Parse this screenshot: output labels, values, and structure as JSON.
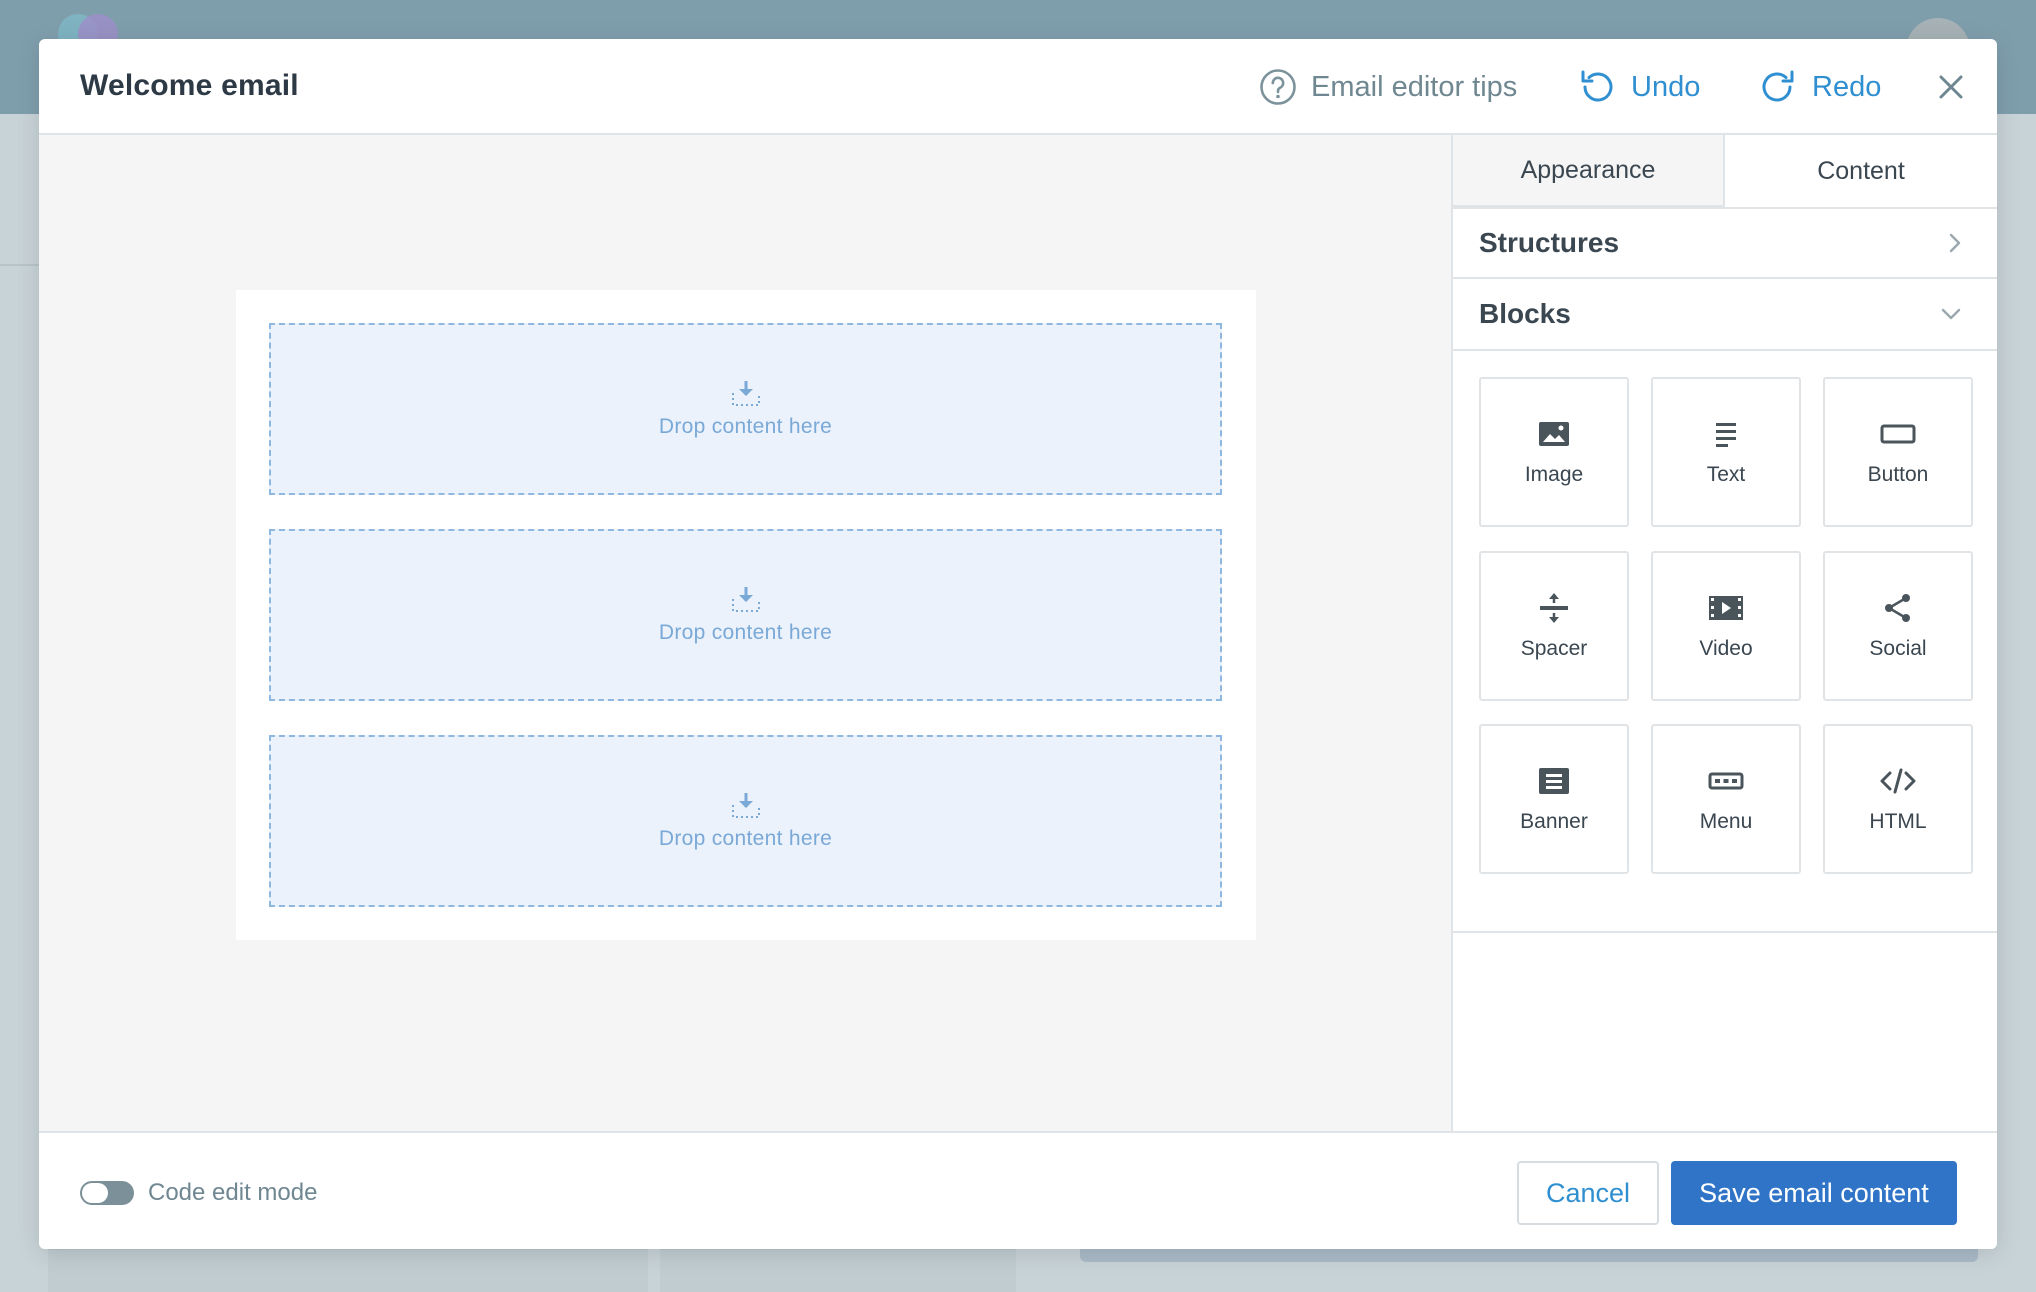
{
  "modal": {
    "title": "Welcome email",
    "tips_label": "Email editor tips",
    "undo_label": "Undo",
    "redo_label": "Redo"
  },
  "canvas": {
    "drop_zones": [
      {
        "label": "Drop content here"
      },
      {
        "label": "Drop content here"
      },
      {
        "label": "Drop content here"
      }
    ]
  },
  "panel": {
    "tabs": [
      {
        "label": "Appearance",
        "active": false
      },
      {
        "label": "Content",
        "active": true
      }
    ],
    "structures_label": "Structures",
    "blocks_label": "Blocks",
    "blocks": [
      {
        "label": "Image",
        "icon": "image-icon"
      },
      {
        "label": "Text",
        "icon": "text-icon"
      },
      {
        "label": "Button",
        "icon": "button-icon"
      },
      {
        "label": "Spacer",
        "icon": "spacer-icon"
      },
      {
        "label": "Video",
        "icon": "video-icon"
      },
      {
        "label": "Social",
        "icon": "share-icon"
      },
      {
        "label": "Banner",
        "icon": "banner-icon"
      },
      {
        "label": "Menu",
        "icon": "menu-icon"
      },
      {
        "label": "HTML",
        "icon": "code-icon"
      }
    ]
  },
  "footer": {
    "code_edit_label": "Code edit mode",
    "code_edit_enabled": false,
    "cancel_label": "Cancel",
    "save_label": "Save email content"
  },
  "colors": {
    "accent": "#2f8fd0",
    "primary_button": "#2f74c6",
    "drop_zone_bg": "#ebf2fb",
    "drop_zone_border": "#8fb8e1"
  }
}
